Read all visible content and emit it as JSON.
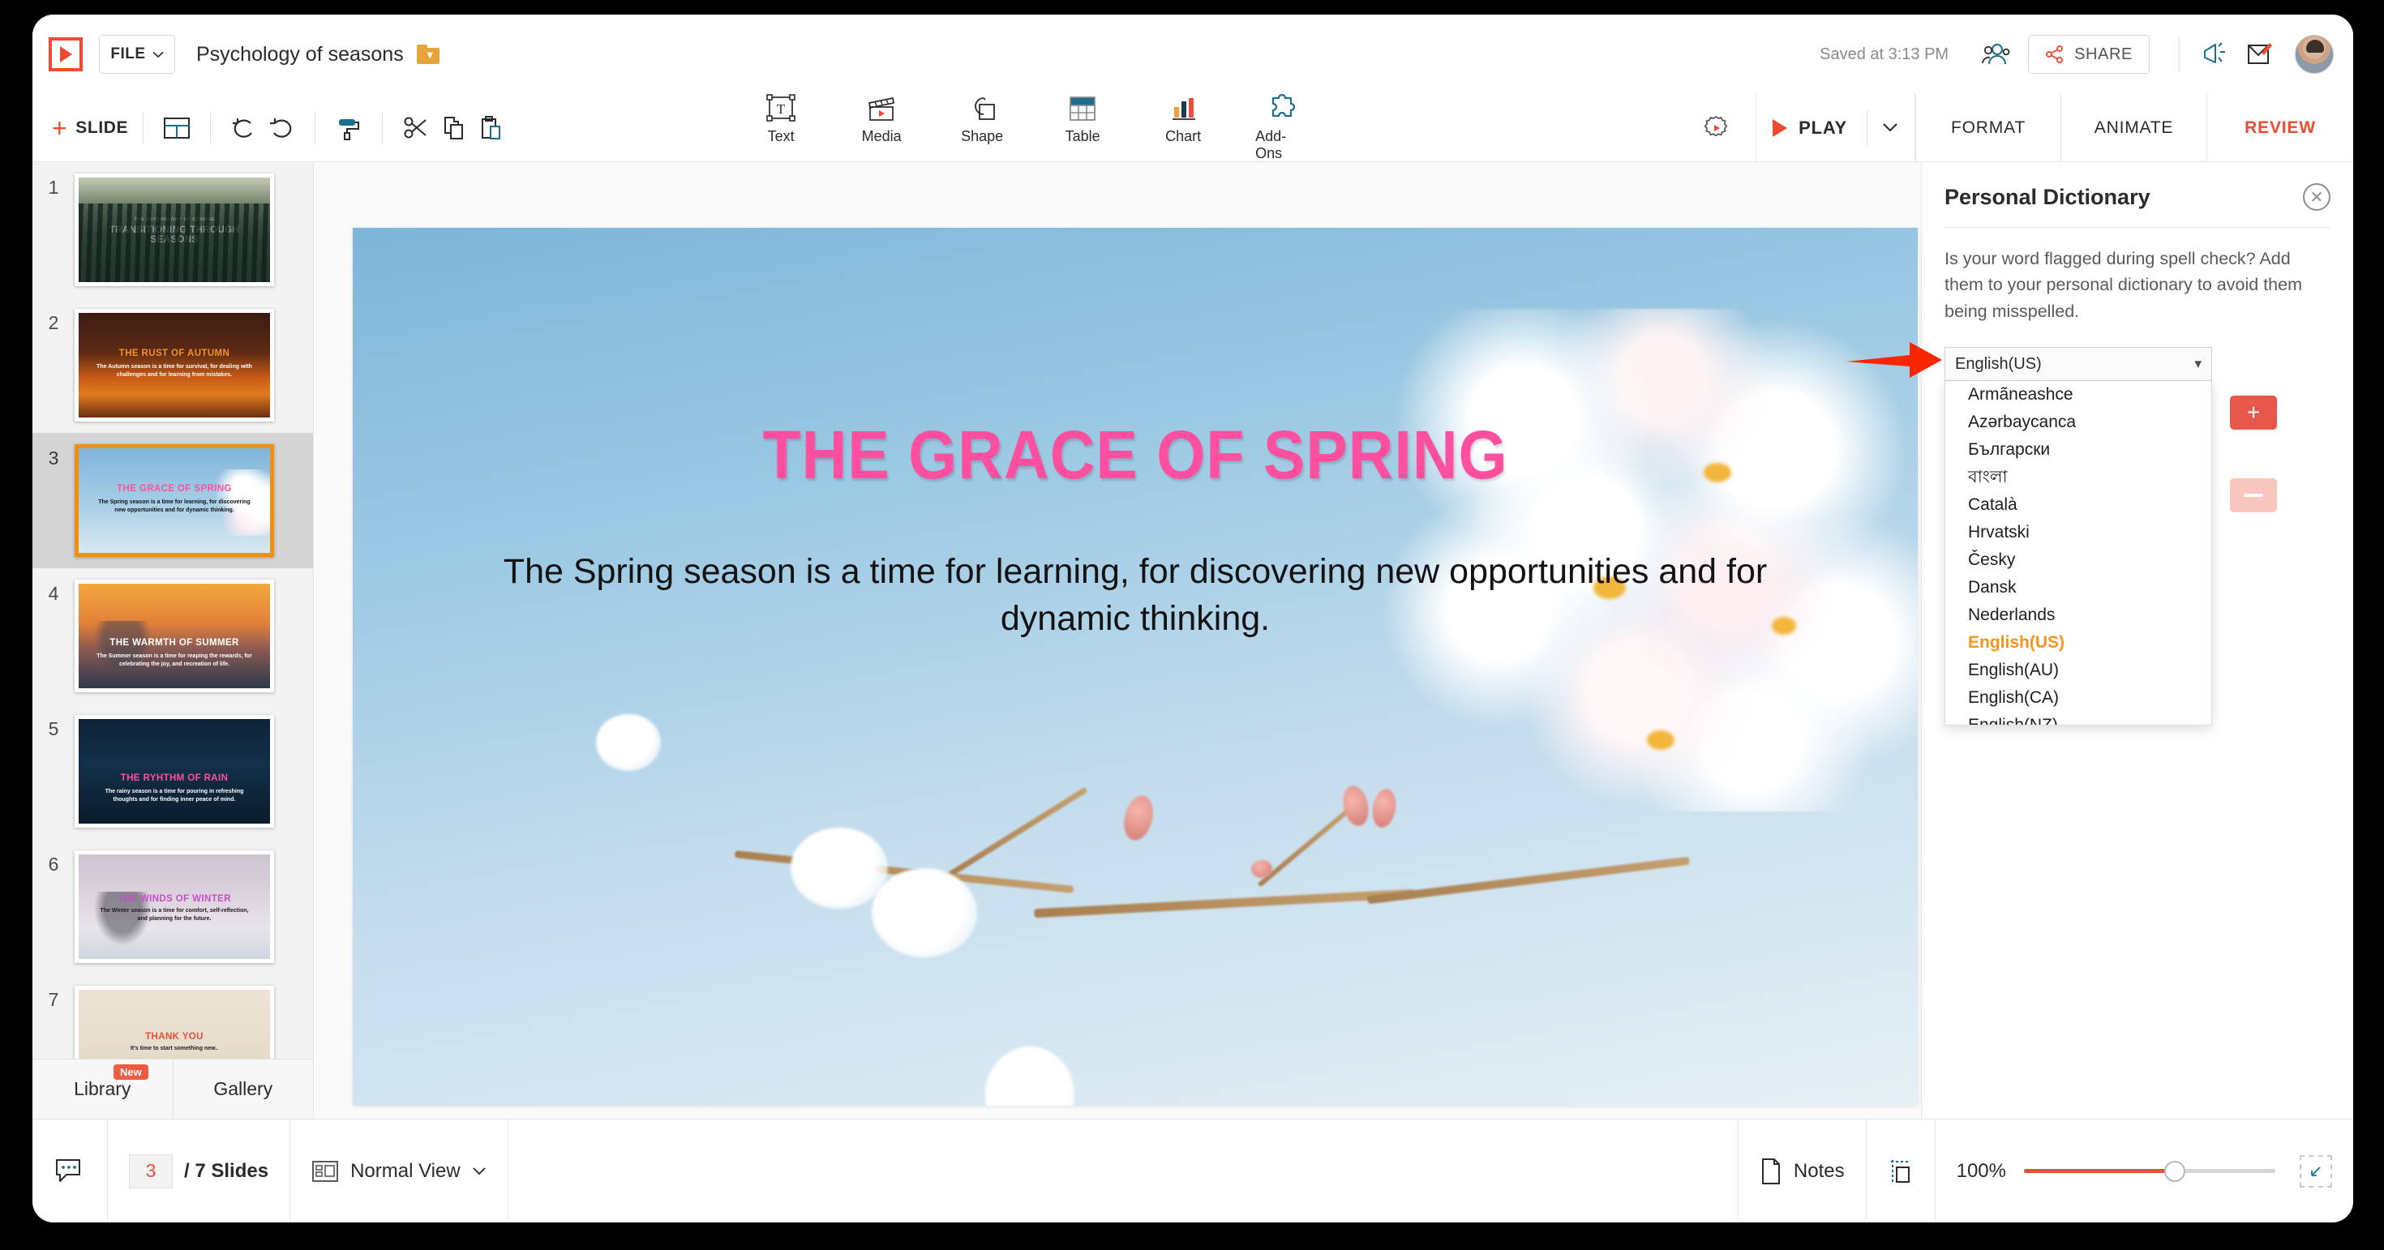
{
  "app": {
    "logo": "zoho-show-logo",
    "file_menu": "FILE",
    "doc_title": "Psychology of seasons",
    "saved_status": "Saved at 3:13 PM",
    "share_label": "SHARE"
  },
  "toolbar": {
    "add_slide_label": "SLIDE",
    "add_slide_plus": "+",
    "insert_items": [
      {
        "label": "Text",
        "icon": "text-box-icon"
      },
      {
        "label": "Media",
        "icon": "media-clapperboard-icon"
      },
      {
        "label": "Shape",
        "icon": "shape-icon"
      },
      {
        "label": "Table",
        "icon": "table-icon"
      },
      {
        "label": "Chart",
        "icon": "bar-chart-icon"
      },
      {
        "label": "Add-Ons",
        "icon": "puzzle-piece-icon"
      }
    ],
    "play_label": "PLAY",
    "tabs": [
      {
        "label": "FORMAT",
        "active": false
      },
      {
        "label": "ANIMATE",
        "active": false
      },
      {
        "label": "REVIEW",
        "active": true
      }
    ]
  },
  "slides": [
    {
      "num": "1",
      "kicker": "THE PSYCHOLOGY OF CHANGE",
      "title": "TRANSITIONING THROUGH SEASONS",
      "subtitle": "",
      "scene": "sc1",
      "title_color": "#ffffff",
      "sub_color": "#ffffff",
      "selected": false
    },
    {
      "num": "2",
      "kicker": "",
      "title": "THE RUST OF AUTUMN",
      "subtitle": "The Autumn season is a time for survival, for dealing with challenges and for learning from mistakes.",
      "scene": "sc2",
      "title_color": "#f5951f",
      "sub_color": "#ffffff",
      "selected": false
    },
    {
      "num": "3",
      "kicker": "",
      "title": "THE GRACE OF SPRING",
      "subtitle": "The Spring season is a time for learning, for discovering new opportunities and for dynamic thinking.",
      "scene": "sc3",
      "title_color": "#ff4f9e",
      "sub_color": "#101010",
      "selected": true
    },
    {
      "num": "4",
      "kicker": "",
      "title": "THE WARMTH OF SUMMER",
      "subtitle": "The Summer season is a time for reaping the rewards, for celebrating the joy, and recreation of life.",
      "scene": "sc4",
      "title_color": "#ffffff",
      "sub_color": "#ffffff",
      "selected": false
    },
    {
      "num": "5",
      "kicker": "",
      "title": "THE RYHTHM OF RAIN",
      "subtitle": "The rainy season is a time for pouring in refreshing thoughts and for finding inner peace of mind.",
      "scene": "sc5",
      "title_color": "#ff4f9e",
      "sub_color": "#ffffff",
      "selected": false
    },
    {
      "num": "6",
      "kicker": "",
      "title": "THE WINDS OF WINTER",
      "subtitle": "The Winter season is a time for comfort, self-reflection, and planning for the future.",
      "scene": "sc6",
      "title_color": "#c44fc9",
      "sub_color": "#1b1b1b",
      "selected": false
    },
    {
      "num": "7",
      "kicker": "",
      "title": "THANK YOU",
      "subtitle": "It's time to start something new..",
      "scene": "sc7",
      "title_color": "#e8503a",
      "sub_color": "#1b1b1b",
      "selected": false
    }
  ],
  "panel_tabs": {
    "library": "Library",
    "library_badge": "New",
    "gallery": "Gallery"
  },
  "canvas": {
    "title": "THE GRACE OF SPRING",
    "body": "The Spring season is a time for learning, for discovering new opportunities and for dynamic thinking.",
    "title_color": "#ff4f9e"
  },
  "right_panel": {
    "title": "Personal Dictionary",
    "close_icon": "close-circle-icon",
    "description": "Is your word flagged during spell check? Add them to your personal dictionary to avoid them being misspelled.",
    "selected_language": "English(US)",
    "add_button": "+",
    "remove_button": "—",
    "languages": [
      {
        "label": "Armãneashce",
        "selected": false
      },
      {
        "label": "Azərbaycanca",
        "selected": false
      },
      {
        "label": "Български",
        "selected": false
      },
      {
        "label": "বাংলা",
        "selected": false
      },
      {
        "label": "Català",
        "selected": false
      },
      {
        "label": "Hrvatski",
        "selected": false
      },
      {
        "label": "Česky",
        "selected": false
      },
      {
        "label": "Dansk",
        "selected": false
      },
      {
        "label": "Nederlands",
        "selected": false
      },
      {
        "label": "English(US)",
        "selected": true
      },
      {
        "label": "English(AU)",
        "selected": false
      },
      {
        "label": "English(CA)",
        "selected": false
      },
      {
        "label": "English(NZ)",
        "selected": false
      }
    ],
    "accent_color": "#f5941e"
  },
  "status_bar": {
    "current_slide": "3",
    "slide_count": "/ 7 Slides",
    "view_mode": "Normal View",
    "notes_label": "Notes",
    "zoom_level": "100%"
  }
}
